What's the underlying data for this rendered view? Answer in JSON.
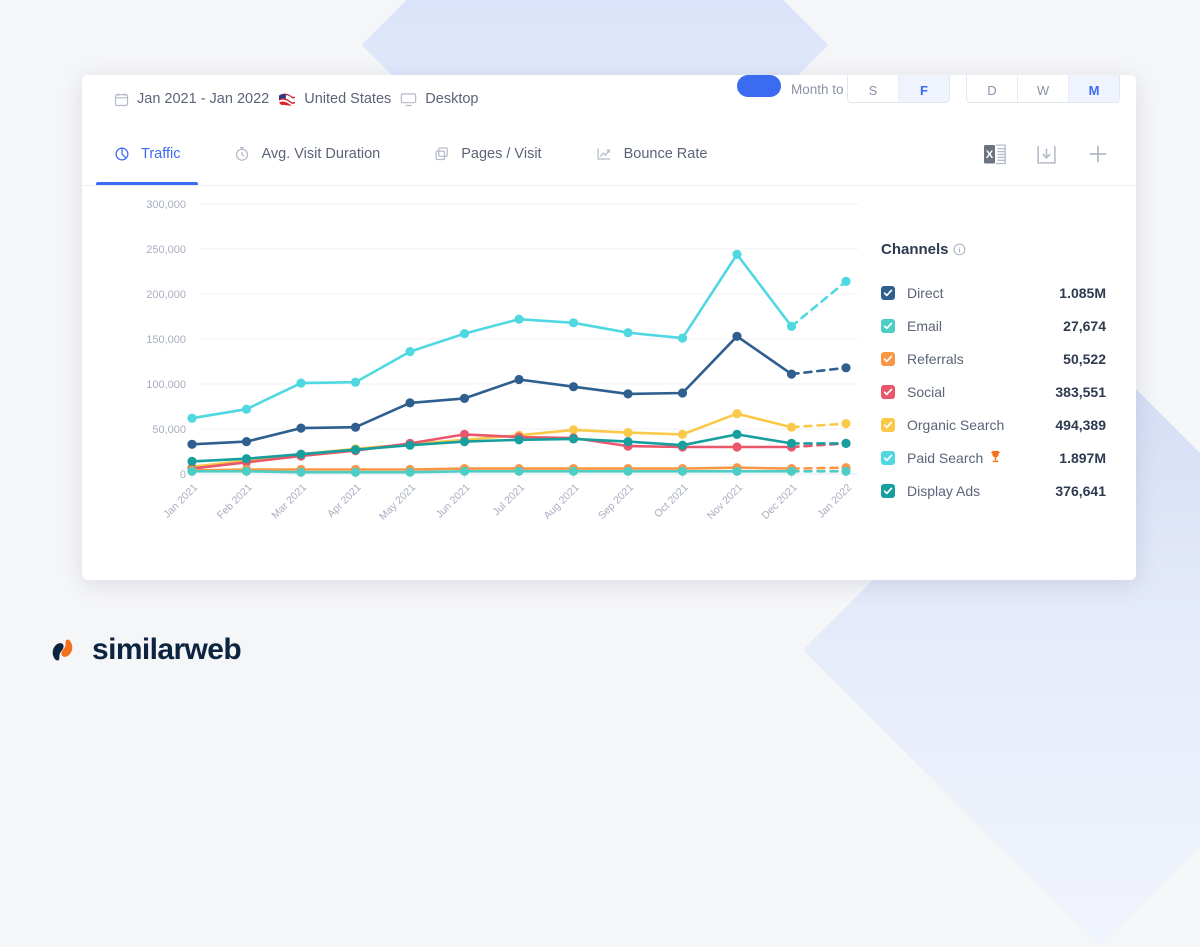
{
  "filters": {
    "date_range": "Jan 2021 - Jan 2022",
    "country": "United States",
    "device": "Desktop",
    "calendar_icon": "calendar-icon",
    "flag_icon": "us-flag-icon",
    "device_icon": "desktop-monitor-icon"
  },
  "top_controls": {
    "month_to_date_label": "Month to date",
    "granularity_left": [
      "S",
      "F"
    ],
    "granularity_left_selected": "F",
    "granularity_right": [
      "D",
      "W",
      "M"
    ],
    "granularity_right_selected": "M"
  },
  "tabs": [
    {
      "label": "Traffic",
      "icon": "pie-chart-icon",
      "active": true
    },
    {
      "label": "Avg. Visit Duration",
      "icon": "stopwatch-icon",
      "active": false
    },
    {
      "label": "Pages / Visit",
      "icon": "copy-pages-icon",
      "active": false
    },
    {
      "label": "Bounce Rate",
      "icon": "trend-line-icon",
      "active": false
    }
  ],
  "tab_actions": [
    {
      "name": "export-excel-icon",
      "label": "Export to Excel"
    },
    {
      "name": "download-icon",
      "label": "Download"
    },
    {
      "name": "add-plus-icon",
      "label": "Add"
    }
  ],
  "legend": {
    "title": "Channels",
    "info_icon": "info-circle-icon",
    "rows": [
      {
        "label": "Direct",
        "value": "1.085M",
        "color": "#2e5f8f",
        "checked": true,
        "badge": null
      },
      {
        "label": "Email",
        "value": "27,674",
        "color": "#4ecdc4",
        "checked": true,
        "badge": null
      },
      {
        "label": "Referrals",
        "value": "50,522",
        "color": "#f99746",
        "checked": true,
        "badge": null
      },
      {
        "label": "Social",
        "value": "383,551",
        "color": "#e8576b",
        "checked": true,
        "badge": null
      },
      {
        "label": "Organic Search",
        "value": "494,389",
        "color": "#fbc94a",
        "checked": true,
        "badge": null
      },
      {
        "label": "Paid Search",
        "value": "1.897M",
        "color": "#4fd8e0",
        "checked": true,
        "badge": "trophy-icon"
      },
      {
        "label": "Display Ads",
        "value": "376,641",
        "color": "#179e9e",
        "checked": true,
        "badge": null
      }
    ]
  },
  "footer": {
    "brand": "similarweb",
    "logo_icon": "similarweb-logo-icon"
  },
  "chart_data": {
    "type": "line",
    "title": "",
    "xlabel": "",
    "ylabel": "",
    "ylim": [
      0,
      300000
    ],
    "yticks": [
      0,
      50000,
      100000,
      150000,
      200000,
      250000,
      300000
    ],
    "ytick_labels": [
      "0",
      "50,000",
      "100,000",
      "150,000",
      "200,000",
      "250,000",
      "300,000"
    ],
    "grid": true,
    "legend_position": "right",
    "forecast_from_index": 11,
    "categories": [
      "Jan 2021",
      "Feb 2021",
      "Mar 2021",
      "Apr 2021",
      "May 2021",
      "Jun 2021",
      "Jul 2021",
      "Aug 2021",
      "Sep 2021",
      "Oct 2021",
      "Nov 2021",
      "Dec 2021",
      "Jan 2022"
    ],
    "series": [
      {
        "name": "Paid Search",
        "color": "#4fd8e0",
        "values": [
          62000,
          72000,
          101000,
          102000,
          136000,
          156000,
          172000,
          168000,
          157000,
          151000,
          244000,
          164000,
          214000
        ]
      },
      {
        "name": "Direct",
        "color": "#2e5f8f",
        "values": [
          33000,
          36000,
          51000,
          52000,
          79000,
          84000,
          105000,
          97000,
          89000,
          90000,
          153000,
          111000,
          118000
        ]
      },
      {
        "name": "Organic Search",
        "color": "#fbc94a",
        "values": [
          8000,
          15000,
          22000,
          28000,
          33000,
          38000,
          43000,
          49000,
          46000,
          44000,
          67000,
          52000,
          56000
        ]
      },
      {
        "name": "Social",
        "color": "#e8576b",
        "values": [
          6000,
          13000,
          20000,
          26000,
          34000,
          44000,
          41000,
          40000,
          31000,
          30000,
          30000,
          30000,
          34000
        ]
      },
      {
        "name": "Display Ads",
        "color": "#179e9e",
        "values": [
          14000,
          17000,
          22000,
          27000,
          32000,
          36000,
          38000,
          39000,
          36000,
          32000,
          44000,
          34000,
          34000
        ]
      },
      {
        "name": "Referrals",
        "color": "#f99746",
        "values": [
          4000,
          5000,
          5000,
          5000,
          5000,
          6000,
          6000,
          6000,
          6000,
          6000,
          7000,
          6000,
          7000
        ]
      },
      {
        "name": "Email",
        "color": "#4ecdc4",
        "values": [
          3000,
          3000,
          2000,
          2000,
          2000,
          3000,
          3000,
          3000,
          3000,
          3000,
          3000,
          3000,
          3000
        ]
      }
    ]
  }
}
